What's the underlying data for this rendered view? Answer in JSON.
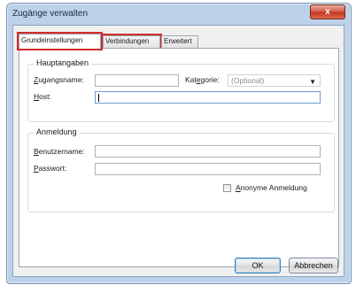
{
  "window": {
    "title": "Zugänge verwalten",
    "close_glyph": "x"
  },
  "tabs": [
    {
      "label": "Grundeinstellungen"
    },
    {
      "label": "Verbindungen"
    },
    {
      "label": "Erweitert"
    }
  ],
  "hauptangaben": {
    "title": "Hauptangaben",
    "zugangsname_label_u": "Z",
    "zugangsname_label_rest": "ugangsname:",
    "zugangsname_value": "",
    "kategorie_label_pre": "Kat",
    "kategorie_label_u": "e",
    "kategorie_label_rest": "gorie:",
    "kategorie_placeholder": "(Optional)",
    "host_label_u": "H",
    "host_label_rest": "ost:",
    "host_value": ""
  },
  "anmeldung": {
    "title": "Anmeldung",
    "benutzername_label_u": "B",
    "benutzername_label_rest": "enutzername:",
    "benutzername_value": "",
    "passwort_label_u": "P",
    "passwort_label_rest": "asswort:",
    "passwort_value": "",
    "anonym_label_u": "A",
    "anonym_label_rest": "nonyme Anmeldung"
  },
  "buttons": {
    "ok": "OK",
    "cancel": "Abbrechen"
  }
}
